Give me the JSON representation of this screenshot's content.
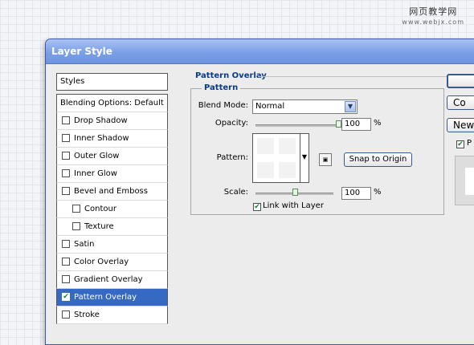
{
  "watermark": {
    "cn": "网页教学网",
    "url": "www.webjx.com"
  },
  "window": {
    "title": "Layer Style"
  },
  "sidebar": {
    "header": "Styles",
    "items": [
      {
        "label": "Blending Options: Default",
        "checkbox": false,
        "checked": false,
        "indent": 0,
        "selected": false
      },
      {
        "label": "Drop Shadow",
        "checkbox": true,
        "checked": false,
        "indent": 0,
        "selected": false
      },
      {
        "label": "Inner Shadow",
        "checkbox": true,
        "checked": false,
        "indent": 0,
        "selected": false
      },
      {
        "label": "Outer Glow",
        "checkbox": true,
        "checked": false,
        "indent": 0,
        "selected": false
      },
      {
        "label": "Inner Glow",
        "checkbox": true,
        "checked": false,
        "indent": 0,
        "selected": false
      },
      {
        "label": "Bevel and Emboss",
        "checkbox": true,
        "checked": false,
        "indent": 0,
        "selected": false
      },
      {
        "label": "Contour",
        "checkbox": true,
        "checked": false,
        "indent": 1,
        "selected": false
      },
      {
        "label": "Texture",
        "checkbox": true,
        "checked": false,
        "indent": 1,
        "selected": false
      },
      {
        "label": "Satin",
        "checkbox": true,
        "checked": false,
        "indent": 0,
        "selected": false
      },
      {
        "label": "Color Overlay",
        "checkbox": true,
        "checked": false,
        "indent": 0,
        "selected": false
      },
      {
        "label": "Gradient Overlay",
        "checkbox": true,
        "checked": false,
        "indent": 0,
        "selected": false
      },
      {
        "label": "Pattern Overlay",
        "checkbox": true,
        "checked": true,
        "indent": 0,
        "selected": true
      },
      {
        "label": "Stroke",
        "checkbox": true,
        "checked": false,
        "indent": 0,
        "selected": false
      }
    ]
  },
  "panel": {
    "title": "Pattern Overlay",
    "group_title": "Pattern",
    "blend_mode": {
      "label": "Blend Mode:",
      "value": "Normal"
    },
    "opacity": {
      "label": "Opacity:",
      "value": "100",
      "unit": "%",
      "level": 1.0
    },
    "pattern": {
      "label": "Pattern:",
      "snap_button": "Snap to Origin"
    },
    "scale": {
      "label": "Scale:",
      "value": "100",
      "unit": "%",
      "level": 0.5
    },
    "link_with_layer": {
      "label": "Link with Layer",
      "checked": true
    }
  },
  "right": {
    "ok_label": "",
    "cancel_label": "Co",
    "new_style_label": "New",
    "preview_label": "P",
    "preview_checked": true
  },
  "colors": {
    "title_bar": "#7b9fe6",
    "selected_row": "#3569c4",
    "section_title": "#0a3a8a",
    "check_mark": "#15803b"
  }
}
